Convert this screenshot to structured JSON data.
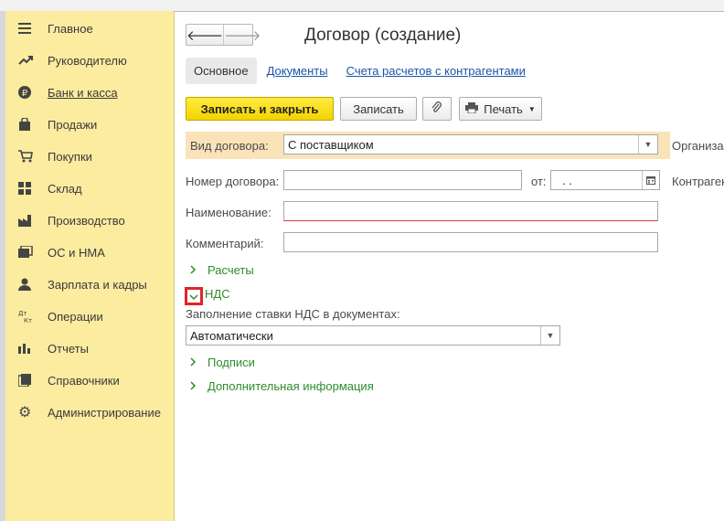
{
  "sidebar": {
    "items": [
      {
        "label": "Главное",
        "icon": "menu-lines-icon"
      },
      {
        "label": "Руководителю",
        "icon": "trend-icon"
      },
      {
        "label": "Банк и касса",
        "icon": "ruble-coin-icon"
      },
      {
        "label": "Продажи",
        "icon": "shopping-bag-icon"
      },
      {
        "label": "Покупки",
        "icon": "cart-icon"
      },
      {
        "label": "Склад",
        "icon": "warehouse-grid-icon"
      },
      {
        "label": "Производство",
        "icon": "factory-icon"
      },
      {
        "label": "ОС и НМА",
        "icon": "folders-icon"
      },
      {
        "label": "Зарплата и кадры",
        "icon": "person-icon"
      },
      {
        "label": "Операции",
        "icon": "dt-kt-icon"
      },
      {
        "label": "Отчеты",
        "icon": "bar-chart-icon"
      },
      {
        "label": "Справочники",
        "icon": "book-icon"
      },
      {
        "label": "Администрирование",
        "icon": "gear-icon"
      }
    ]
  },
  "header": {
    "title": "Договор (создание)"
  },
  "tabs": {
    "main": "Основное",
    "documents": "Документы",
    "settlements": "Счета расчетов с контрагентами"
  },
  "toolbar": {
    "save_close": "Записать и закрыть",
    "save": "Записать",
    "print": "Печать"
  },
  "form": {
    "contract_type_label": "Вид договора:",
    "contract_type_value": "С поставщиком",
    "organization_label": "Организа",
    "number_label": "Номер договора:",
    "number_value": "",
    "date_label": "от:",
    "date_value": ".  .",
    "counterparty_label": "Контраген",
    "name_label": "Наименование:",
    "name_value": "",
    "comment_label": "Комментарий:",
    "comment_value": ""
  },
  "groups": {
    "settlements": "Расчеты",
    "vat": "НДС",
    "signatures": "Подписи",
    "additional": "Дополнительная информация"
  },
  "vat": {
    "fill_label": "Заполнение ставки НДС в документах:",
    "fill_value": "Автоматически"
  },
  "colors": {
    "sidebar_bg": "#fbeca0",
    "primary_button": "#f3d300",
    "group_link": "#2e8b2e",
    "highlight_box": "#e0242c"
  }
}
